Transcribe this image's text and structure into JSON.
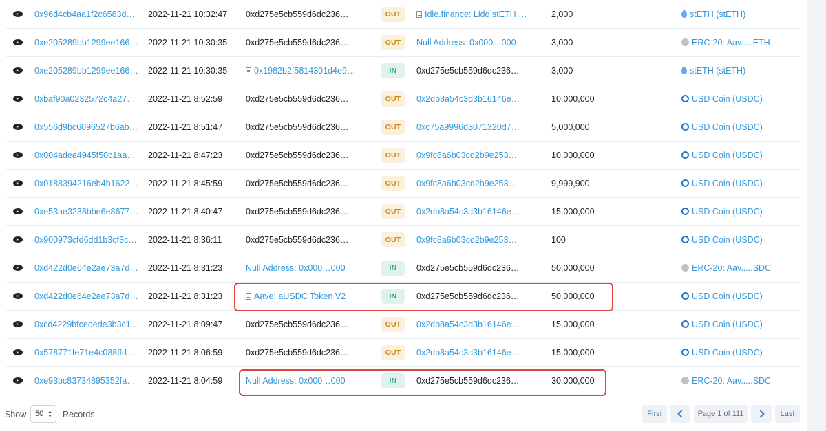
{
  "rows": [
    {
      "hash": "0x96d4cb4aa1f2c6583d…",
      "time": "2022-11-21 10:32:47",
      "from": "0xd275e5cb559d6dc236…",
      "from_style": "plain",
      "direction": "OUT",
      "to": "Idle.finance: Lido stETH …",
      "to_style": "link-doc",
      "quantity": "2,000",
      "token": "stETH (stETH)",
      "token_icon": "steth-icon"
    },
    {
      "hash": "0xe205289bb1299ee166…",
      "time": "2022-11-21 10:30:35",
      "from": "0xd275e5cb559d6dc236…",
      "from_style": "plain",
      "direction": "OUT",
      "to": "Null Address: 0x000…000",
      "to_style": "link",
      "quantity": "3,000",
      "token": "ERC-20: Aav.....ETH",
      "token_icon": "erc20-icon"
    },
    {
      "hash": "0xe205289bb1299ee166…",
      "time": "2022-11-21 10:30:35",
      "from": "0x1982b2f5814301d4e9…",
      "from_style": "link-doc",
      "direction": "IN",
      "to": "0xd275e5cb559d6dc236…",
      "to_style": "plain",
      "quantity": "3,000",
      "token": "stETH (stETH)",
      "token_icon": "steth-icon"
    },
    {
      "hash": "0xbaf90a0232572c4a27…",
      "time": "2022-11-21 8:52:59",
      "from": "0xd275e5cb559d6dc236…",
      "from_style": "plain",
      "direction": "OUT",
      "to": "0x2db8a54c3d3b16146e…",
      "to_style": "link",
      "quantity": "10,000,000",
      "token": "USD Coin (USDC)",
      "token_icon": "usdc-icon"
    },
    {
      "hash": "0x556d9bc6096527b6ab…",
      "time": "2022-11-21 8:51:47",
      "from": "0xd275e5cb559d6dc236…",
      "from_style": "plain",
      "direction": "OUT",
      "to": "0xc75a9996d3071320d7…",
      "to_style": "link",
      "quantity": "5,000,000",
      "token": "USD Coin (USDC)",
      "token_icon": "usdc-icon"
    },
    {
      "hash": "0x004adea4945f50c1aa…",
      "time": "2022-11-21 8:47:23",
      "from": "0xd275e5cb559d6dc236…",
      "from_style": "plain",
      "direction": "OUT",
      "to": "0x9fc8a6b03cd2b9e253…",
      "to_style": "link",
      "quantity": "10,000,000",
      "token": "USD Coin (USDC)",
      "token_icon": "usdc-icon"
    },
    {
      "hash": "0x0188394216eb4b1622…",
      "time": "2022-11-21 8:45:59",
      "from": "0xd275e5cb559d6dc236…",
      "from_style": "plain",
      "direction": "OUT",
      "to": "0x9fc8a6b03cd2b9e253…",
      "to_style": "link",
      "quantity": "9,999,900",
      "token": "USD Coin (USDC)",
      "token_icon": "usdc-icon"
    },
    {
      "hash": "0xe53ae3238bbe6e8677…",
      "time": "2022-11-21 8:40:47",
      "from": "0xd275e5cb559d6dc236…",
      "from_style": "plain",
      "direction": "OUT",
      "to": "0x2db8a54c3d3b16146e…",
      "to_style": "link",
      "quantity": "15,000,000",
      "token": "USD Coin (USDC)",
      "token_icon": "usdc-icon"
    },
    {
      "hash": "0x900973cfd6dd1b3cf3c…",
      "time": "2022-11-21 8:36:11",
      "from": "0xd275e5cb559d6dc236…",
      "from_style": "plain",
      "direction": "OUT",
      "to": "0x9fc8a6b03cd2b9e253…",
      "to_style": "link",
      "quantity": "100",
      "token": "USD Coin (USDC)",
      "token_icon": "usdc-icon"
    },
    {
      "hash": "0xd422d0e64e2ae73a7d…",
      "time": "2022-11-21 8:31:23",
      "from": "Null Address: 0x000…000",
      "from_style": "link",
      "direction": "IN",
      "to": "0xd275e5cb559d6dc236…",
      "to_style": "plain",
      "quantity": "50,000,000",
      "token": "ERC-20: Aav.....SDC",
      "token_icon": "erc20-icon"
    },
    {
      "hash": "0xd422d0e64e2ae73a7d…",
      "time": "2022-11-21 8:31:23",
      "from": "Aave: aUSDC Token V2",
      "from_style": "link-doc",
      "direction": "IN",
      "to": "0xd275e5cb559d6dc236…",
      "to_style": "plain",
      "quantity": "50,000,000",
      "token": "USD Coin (USDC)",
      "token_icon": "usdc-icon"
    },
    {
      "hash": "0xcd4229bfcedede3b3c1…",
      "time": "2022-11-21 8:09:47",
      "from": "0xd275e5cb559d6dc236…",
      "from_style": "plain",
      "direction": "OUT",
      "to": "0x2db8a54c3d3b16146e…",
      "to_style": "link",
      "quantity": "15,000,000",
      "token": "USD Coin (USDC)",
      "token_icon": "usdc-icon"
    },
    {
      "hash": "0x578771fe71e4c088ffd…",
      "time": "2022-11-21 8:06:59",
      "from": "0xd275e5cb559d6dc236…",
      "from_style": "plain",
      "direction": "OUT",
      "to": "0x2db8a54c3d3b16146e…",
      "to_style": "link",
      "quantity": "15,000,000",
      "token": "USD Coin (USDC)",
      "token_icon": "usdc-icon"
    },
    {
      "hash": "0xe93bc83734895352fa…",
      "time": "2022-11-21 8:04:59",
      "from": "Null Address: 0x000…000",
      "from_style": "link",
      "direction": "IN",
      "to": "0xd275e5cb559d6dc236…",
      "to_style": "plain",
      "quantity": "30,000,000",
      "token": "ERC-20: Aav.....SDC",
      "token_icon": "erc20-icon"
    }
  ],
  "footer": {
    "show_label": "Show",
    "page_size": "50",
    "records_label": "Records",
    "first_label": "First",
    "page_info": "Page 1 of 111",
    "last_label": "Last"
  },
  "colors": {
    "link": "#3498db",
    "out_badge_bg": "#fbf0dc",
    "out_badge_text": "#c58a1d",
    "in_badge_bg": "#dff3ec",
    "in_badge_text": "#2ca27a",
    "highlight": "#d9483b"
  }
}
